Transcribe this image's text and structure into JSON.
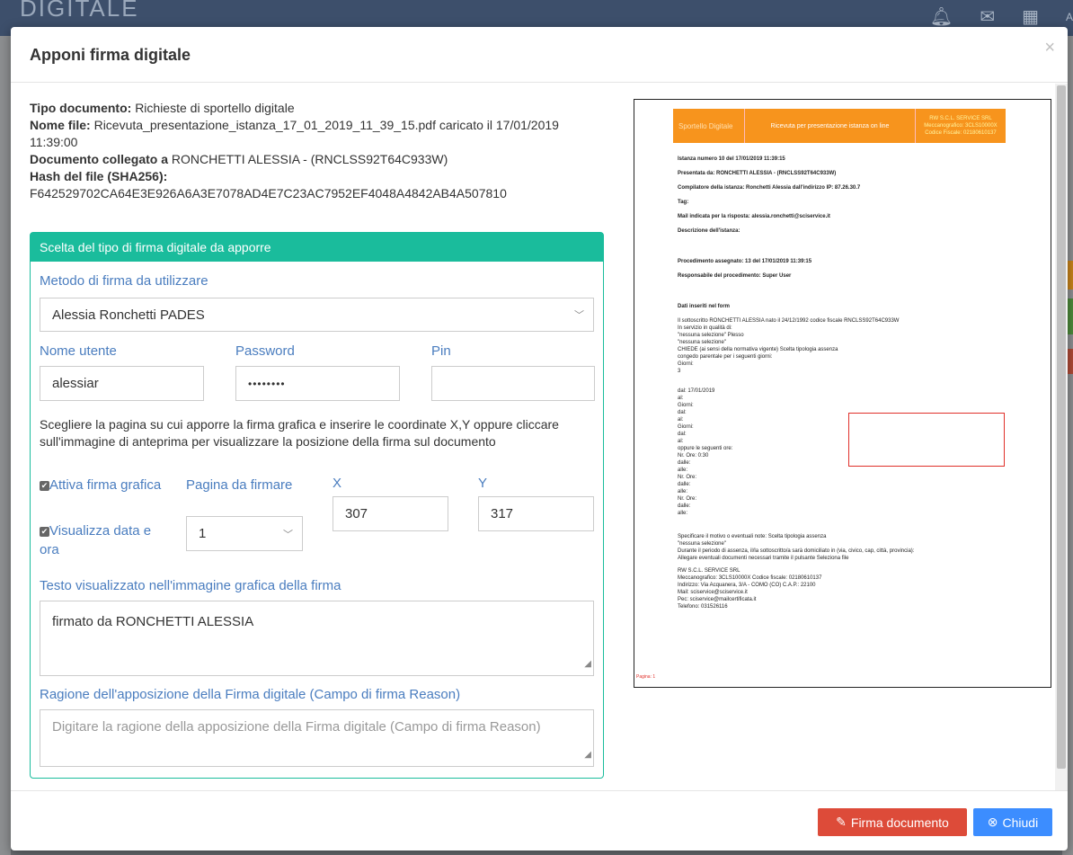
{
  "background": {
    "brand": "DIGITALE",
    "avatar_letter": "A"
  },
  "modal": {
    "title": "Apponi firma digitale",
    "close": "×"
  },
  "info": {
    "tipo_label": "Tipo documento:",
    "tipo_value": "Richieste di sportello digitale",
    "nome_label": "Nome file:",
    "nome_value": "Ricevuta_presentazione_istanza_17_01_2019_11_39_15.pdf caricato il 17/01/2019 11:39:00",
    "collegato_label": "Documento collegato a",
    "collegato_value": "RONCHETTI ALESSIA - (RNCLSS92T64C933W)",
    "hash_label": "Hash del file (SHA256):",
    "hash_value": "F642529702CA64E3E926A6A3E7078AD4E7C23AC7952EF4048A4842AB4A507810"
  },
  "panel": {
    "heading": "Scelta del tipo di firma digitale da apporre",
    "metodo_label": "Metodo di firma da utilizzare",
    "metodo_value": "Alessia Ronchetti PADES",
    "nome_utente_label": "Nome utente",
    "nome_utente_value": "alessiar",
    "password_label": "Password",
    "password_value": "••••••••",
    "pin_label": "Pin",
    "pin_value": "",
    "help": "Scegliere la pagina su cui apporre la firma grafica e inserire le coordinate X,Y oppure cliccare sull'immagine di anteprima per visualizzare la posizione della firma sul documento",
    "attiva_label": "Attiva firma grafica",
    "visualizza_label": "Visualizza data e ora",
    "pagina_label": "Pagina da firmare",
    "pagina_value": "1",
    "x_label": "X",
    "x_value": "307",
    "y_label": "Y",
    "y_value": "317",
    "testo_label": "Testo visualizzato nell'immagine grafica della firma",
    "testo_value": "firmato da RONCHETTI ALESSIA",
    "ragione_label": "Ragione dell'apposizione della Firma digitale (Campo di firma Reason)",
    "ragione_placeholder": "Digitare la ragione della apposizione della Firma digitale (Campo di firma Reason)"
  },
  "preview": {
    "header_left": "Sportello Digitale",
    "header_mid": "Ricevuta per presentazione istanza on line",
    "header_right": "RW S.C.L. SERVICE SRL Meccanografico: 3CLS10000X Codice Fiscale: 02180610137",
    "lines": [
      "Istanza numero 10 del 17/01/2019 11:39:15",
      "Presentata da: RONCHETTI ALESSIA - (RNCLSS92T64C933W)",
      "Compilatore della istanza: Ronchetti Alessia dall'indirizzo IP: 87.26.30.7",
      "Tag:",
      "Mail indicata per la risposta: alessia.ronchetti@sciservice.it",
      "Descrizione dell'istanza:",
      "Procedimento assegnato: 13 del 17/01/2019 11:39:15",
      "Responsabile del procedimento: Super User",
      "Dati inseriti nel form",
      "Il sottoscritto RONCHETTI ALESSIA nato il 24/12/1992 codice fiscale RNCLSS92T64C933W",
      "In servizio in qualità di:",
      "\"nessuna selezione\" Plesso",
      "\"nessuna selezione\"",
      "CHIEDE (ai sensi della normativa vigente) Scelta tipologia assenza",
      "congedo parentale per i seguenti giorni:",
      "Giorni:",
      "3",
      "dal: 17/01/2019",
      "al:",
      "Giorni:",
      "dal:",
      "al:",
      "Giorni:",
      "dal:",
      "al:",
      "oppure le seguenti ore:",
      "Nr. Ore: 0:30",
      "dalle:",
      "alle:",
      "Nr. Ore:",
      "dalle:",
      "alle:",
      "Nr. Ore:",
      "dalle:",
      "alle:",
      "Specificare il motivo o eventuali note: Scelta tipologia assenza",
      "\"nessuna selezione\"",
      "Durante il periodo di assenza, il/la sottoscritto/a sarà domiciliato in (via, civico, cap, città, provincia):",
      "Allegare eventuali documenti necessari tramite il pulsante Seleziona file",
      "RW S.C.L. SERVICE SRL",
      "Meccanografico: 3CLS10000X Codice fiscale: 02180610137",
      "Indirizzo: Via Acquanera, 3/A - COMO (CO) C.A.P.: 22100",
      "Mail: sciservice@sciservice.it",
      "Pec: sciservice@mailcertificata.it",
      "Telefono: 031526116"
    ],
    "page_label": "Pagina: 1"
  },
  "footer": {
    "firma_label": "Firma documento",
    "chiudi_label": "Chiudi"
  },
  "colors": {
    "accent": "#1abc9c",
    "label_blue": "#4a7dbf",
    "btn_red": "#dd4b39",
    "btn_blue": "#3c8dff",
    "preview_orange": "#f7941d"
  }
}
